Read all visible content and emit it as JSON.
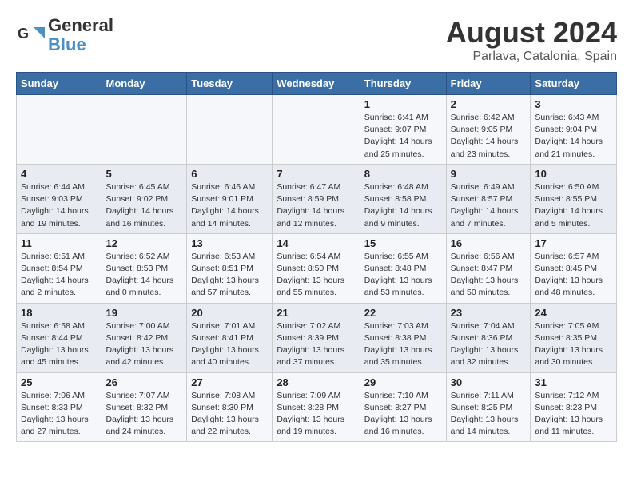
{
  "header": {
    "logo_line1": "General",
    "logo_line2": "Blue",
    "month": "August 2024",
    "location": "Parlava, Catalonia, Spain"
  },
  "weekdays": [
    "Sunday",
    "Monday",
    "Tuesday",
    "Wednesday",
    "Thursday",
    "Friday",
    "Saturday"
  ],
  "weeks": [
    [
      {
        "num": "",
        "info": ""
      },
      {
        "num": "",
        "info": ""
      },
      {
        "num": "",
        "info": ""
      },
      {
        "num": "",
        "info": ""
      },
      {
        "num": "1",
        "info": "Sunrise: 6:41 AM\nSunset: 9:07 PM\nDaylight: 14 hours\nand 25 minutes."
      },
      {
        "num": "2",
        "info": "Sunrise: 6:42 AM\nSunset: 9:05 PM\nDaylight: 14 hours\nand 23 minutes."
      },
      {
        "num": "3",
        "info": "Sunrise: 6:43 AM\nSunset: 9:04 PM\nDaylight: 14 hours\nand 21 minutes."
      }
    ],
    [
      {
        "num": "4",
        "info": "Sunrise: 6:44 AM\nSunset: 9:03 PM\nDaylight: 14 hours\nand 19 minutes."
      },
      {
        "num": "5",
        "info": "Sunrise: 6:45 AM\nSunset: 9:02 PM\nDaylight: 14 hours\nand 16 minutes."
      },
      {
        "num": "6",
        "info": "Sunrise: 6:46 AM\nSunset: 9:01 PM\nDaylight: 14 hours\nand 14 minutes."
      },
      {
        "num": "7",
        "info": "Sunrise: 6:47 AM\nSunset: 8:59 PM\nDaylight: 14 hours\nand 12 minutes."
      },
      {
        "num": "8",
        "info": "Sunrise: 6:48 AM\nSunset: 8:58 PM\nDaylight: 14 hours\nand 9 minutes."
      },
      {
        "num": "9",
        "info": "Sunrise: 6:49 AM\nSunset: 8:57 PM\nDaylight: 14 hours\nand 7 minutes."
      },
      {
        "num": "10",
        "info": "Sunrise: 6:50 AM\nSunset: 8:55 PM\nDaylight: 14 hours\nand 5 minutes."
      }
    ],
    [
      {
        "num": "11",
        "info": "Sunrise: 6:51 AM\nSunset: 8:54 PM\nDaylight: 14 hours\nand 2 minutes."
      },
      {
        "num": "12",
        "info": "Sunrise: 6:52 AM\nSunset: 8:53 PM\nDaylight: 14 hours\nand 0 minutes."
      },
      {
        "num": "13",
        "info": "Sunrise: 6:53 AM\nSunset: 8:51 PM\nDaylight: 13 hours\nand 57 minutes."
      },
      {
        "num": "14",
        "info": "Sunrise: 6:54 AM\nSunset: 8:50 PM\nDaylight: 13 hours\nand 55 minutes."
      },
      {
        "num": "15",
        "info": "Sunrise: 6:55 AM\nSunset: 8:48 PM\nDaylight: 13 hours\nand 53 minutes."
      },
      {
        "num": "16",
        "info": "Sunrise: 6:56 AM\nSunset: 8:47 PM\nDaylight: 13 hours\nand 50 minutes."
      },
      {
        "num": "17",
        "info": "Sunrise: 6:57 AM\nSunset: 8:45 PM\nDaylight: 13 hours\nand 48 minutes."
      }
    ],
    [
      {
        "num": "18",
        "info": "Sunrise: 6:58 AM\nSunset: 8:44 PM\nDaylight: 13 hours\nand 45 minutes."
      },
      {
        "num": "19",
        "info": "Sunrise: 7:00 AM\nSunset: 8:42 PM\nDaylight: 13 hours\nand 42 minutes."
      },
      {
        "num": "20",
        "info": "Sunrise: 7:01 AM\nSunset: 8:41 PM\nDaylight: 13 hours\nand 40 minutes."
      },
      {
        "num": "21",
        "info": "Sunrise: 7:02 AM\nSunset: 8:39 PM\nDaylight: 13 hours\nand 37 minutes."
      },
      {
        "num": "22",
        "info": "Sunrise: 7:03 AM\nSunset: 8:38 PM\nDaylight: 13 hours\nand 35 minutes."
      },
      {
        "num": "23",
        "info": "Sunrise: 7:04 AM\nSunset: 8:36 PM\nDaylight: 13 hours\nand 32 minutes."
      },
      {
        "num": "24",
        "info": "Sunrise: 7:05 AM\nSunset: 8:35 PM\nDaylight: 13 hours\nand 30 minutes."
      }
    ],
    [
      {
        "num": "25",
        "info": "Sunrise: 7:06 AM\nSunset: 8:33 PM\nDaylight: 13 hours\nand 27 minutes."
      },
      {
        "num": "26",
        "info": "Sunrise: 7:07 AM\nSunset: 8:32 PM\nDaylight: 13 hours\nand 24 minutes."
      },
      {
        "num": "27",
        "info": "Sunrise: 7:08 AM\nSunset: 8:30 PM\nDaylight: 13 hours\nand 22 minutes."
      },
      {
        "num": "28",
        "info": "Sunrise: 7:09 AM\nSunset: 8:28 PM\nDaylight: 13 hours\nand 19 minutes."
      },
      {
        "num": "29",
        "info": "Sunrise: 7:10 AM\nSunset: 8:27 PM\nDaylight: 13 hours\nand 16 minutes."
      },
      {
        "num": "30",
        "info": "Sunrise: 7:11 AM\nSunset: 8:25 PM\nDaylight: 13 hours\nand 14 minutes."
      },
      {
        "num": "31",
        "info": "Sunrise: 7:12 AM\nSunset: 8:23 PM\nDaylight: 13 hours\nand 11 minutes."
      }
    ]
  ]
}
